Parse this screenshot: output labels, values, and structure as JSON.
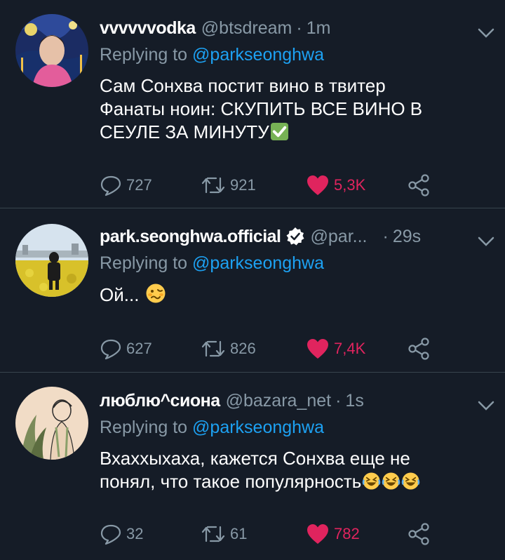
{
  "colors": {
    "background": "#151c27",
    "divider": "#38444d",
    "secondary_text": "#8899a6",
    "mention": "#1da1f2",
    "like": "#e0245e",
    "verified": "#ffffff"
  },
  "reply_label": "Replying to",
  "tweets": [
    {
      "name": "vvvvvvodka",
      "handle": "@btsdream",
      "separator": "·",
      "time": "1m",
      "reply_to": "@parkseonghwa",
      "text": "Сам Сонхва постит вино в твитер\nФанаты ноин: СКУПИТЬ ВСЕ ВИНО В\nСЕУЛЕ ЗА МИНУТУ",
      "emoji": [
        "check-mark-button"
      ],
      "replies": "727",
      "retweets": "921",
      "likes": "5,3K",
      "liked": true,
      "verified": false
    },
    {
      "name": "park.seonghwa.official",
      "handle": "@par...",
      "separator": "·",
      "time": "29s",
      "reply_to": "@parkseonghwa",
      "text": "Ой...",
      "emoji": [
        "woozy-face"
      ],
      "replies": "627",
      "retweets": "826",
      "likes": "7,4K",
      "liked": true,
      "verified": true
    },
    {
      "name": "люблю^сиона",
      "handle": "@bazara_net",
      "separator": "·",
      "time": "1s",
      "reply_to": "@parkseonghwa",
      "text": "Вхаххыхаха, кажется Сонхва еще не\nпонял, что такое популярность",
      "emoji": [
        "rofl-face",
        "rofl-face",
        "rofl-face"
      ],
      "replies": "32",
      "retweets": "61",
      "likes": "782",
      "liked": true,
      "verified": false
    }
  ]
}
